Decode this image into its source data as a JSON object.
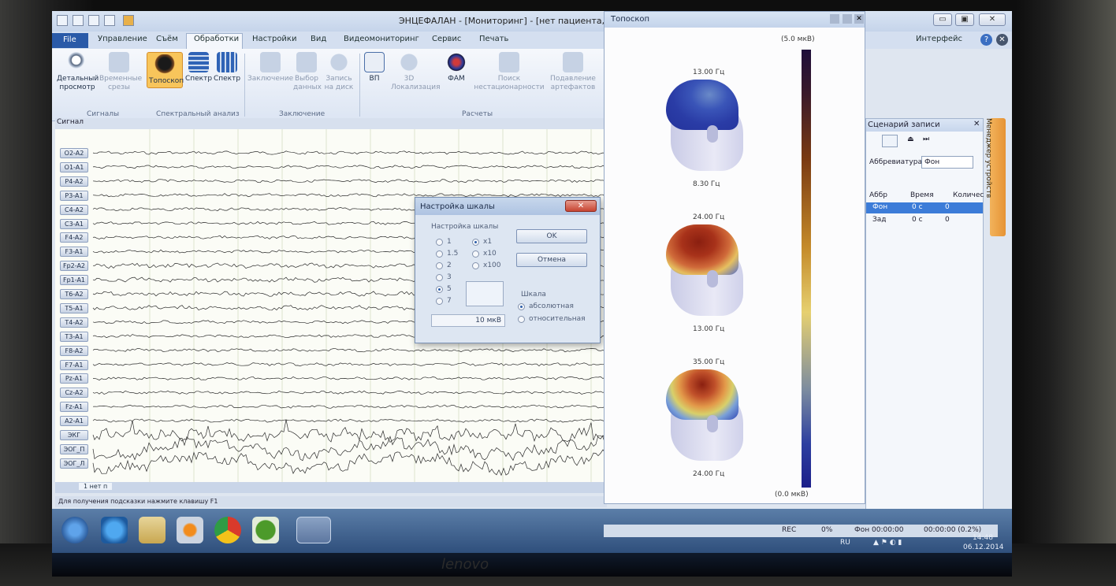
{
  "window": {
    "title": "ЭНЦЕФАЛАН - [Мониторинг] - [нет пациента, муж., ",
    "min": "▭",
    "max": "▣",
    "close": "✕"
  },
  "menu": {
    "file": "File",
    "tabs": [
      "Управление",
      "Съём",
      "Обработки",
      "Настройки",
      "Вид",
      "Видеомониторинг",
      "Сервис",
      "Печать"
    ],
    "interface": "Интерфейс",
    "help": "?",
    "close": "✕"
  },
  "ribbon": {
    "buttons": [
      {
        "label": "Детальный просмотр",
        "state": "normal"
      },
      {
        "label": "Временные срезы",
        "state": "disabled"
      },
      {
        "label": "Топоскоп",
        "state": "active"
      },
      {
        "label": "Спектр",
        "state": "normal"
      },
      {
        "label": "Спектр",
        "state": "normal"
      },
      {
        "label": "Заключение",
        "state": "disabled"
      },
      {
        "label": "Выбор данных",
        "state": "disabled"
      },
      {
        "label": "Запись на диск",
        "state": "disabled"
      },
      {
        "label": "ВП",
        "state": "normal"
      },
      {
        "label": "3D Локализация",
        "state": "disabled"
      },
      {
        "label": "ФАМ",
        "state": "normal"
      },
      {
        "label": "Поиск нестационарности",
        "state": "disabled"
      },
      {
        "label": "Подавление артефактов",
        "state": "disabled"
      }
    ],
    "groups": [
      "Сигналы",
      "Спектральный анализ",
      "Заключение",
      "Расчеты"
    ]
  },
  "signal": {
    "header": "Сигнал",
    "channels": [
      "O2-A2",
      "O1-A1",
      "P4-A2",
      "P3-A1",
      "C4-A2",
      "C3-A1",
      "F4-A2",
      "F3-A1",
      "Fp2-A2",
      "Fp1-A1",
      "T6-A2",
      "T5-A1",
      "T4-A2",
      "T3-A1",
      "F8-A2",
      "F7-A1",
      "Pz-A1",
      "Cz-A2",
      "Fz-A1",
      "A2-A1",
      "ЭКГ",
      "ЭОГ_П",
      "ЭОГ_Л"
    ],
    "tab": "1 нет п",
    "hint": "Для получения подсказки нажмите клавишу F1"
  },
  "dialog": {
    "title": "Настройка шкалы",
    "close": "✕",
    "group_label": "Настройка шкалы",
    "values": [
      "1",
      "1.5",
      "2",
      "3",
      "5",
      "7"
    ],
    "selected_value": "5",
    "multipliers": [
      "x1",
      "x10",
      "x100"
    ],
    "selected_multiplier": "x1",
    "amplitude": "10 мкВ",
    "ok": "OK",
    "cancel": "Отмена",
    "scale_label": "Шкала",
    "scale_options": [
      "абсолютная",
      "относительная"
    ],
    "selected_scale": "абсолютная"
  },
  "topo": {
    "title": "Топоскоп",
    "max_label": "(5.0 мкВ)",
    "min_label": "(0.0 мкВ)",
    "maps": [
      {
        "top": "13.00 Гц",
        "bottom": "8.30 Гц"
      },
      {
        "top": "24.00 Гц",
        "bottom": "13.00 Гц"
      },
      {
        "top": "35.00 Гц",
        "bottom": "24.00 Гц"
      }
    ]
  },
  "scenario": {
    "title": "Сценарий записи",
    "abbr_label": "Аббревиатура",
    "abbr_value": "Фон",
    "columns": [
      "Аббр",
      "Время",
      "Количес"
    ],
    "rows": [
      {
        "abbr": "Фон",
        "time": "0 с",
        "count": "0"
      },
      {
        "abbr": "Зад",
        "time": "0 с",
        "count": "0"
      }
    ],
    "manager": "Менеджер устройств"
  },
  "status": {
    "rec": "REC",
    "percent": "0%",
    "bg_time": "Фон 00:00:00",
    "total": "00:00:00 (0.2%)"
  },
  "tray": {
    "lang": "RU",
    "time": "14:48",
    "date": "06.12.2014"
  },
  "colors": {
    "ribbon_active": "#f8c55b",
    "file_tab": "#2a5aa8",
    "eeg_trace": "#2b2b2b",
    "dialog_close": "#c74432"
  }
}
